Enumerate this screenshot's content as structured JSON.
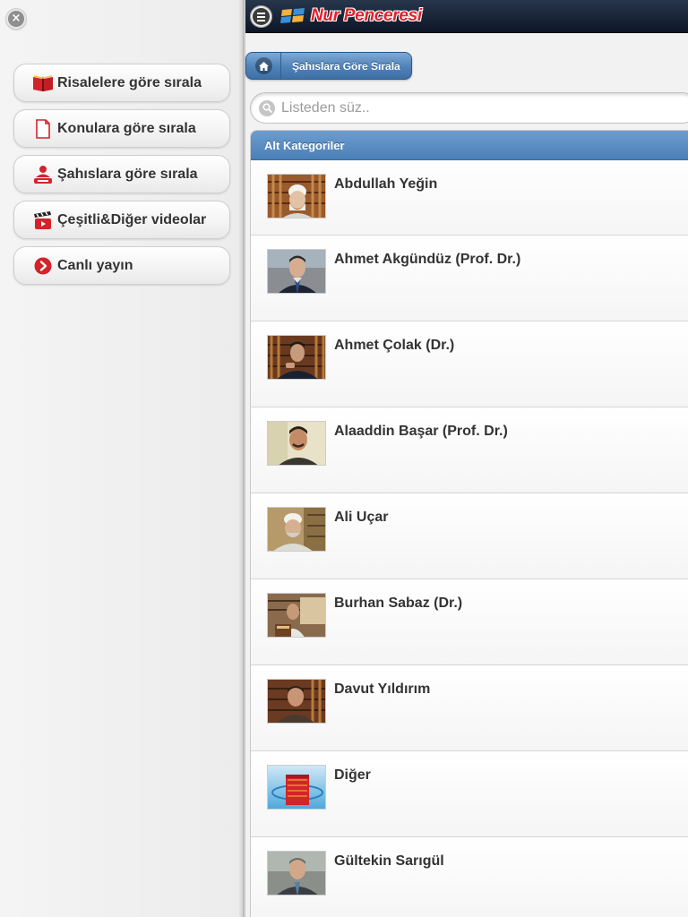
{
  "side_menu": {
    "close_icon": "close-icon",
    "items": [
      {
        "label": "Risalelere göre sırala",
        "icon": "book-icon"
      },
      {
        "label": "Konulara göre sırala",
        "icon": "document-icon"
      },
      {
        "label": "Şahıslara göre sırala",
        "icon": "person-icon"
      },
      {
        "label": "Çeşitli&Diğer videolar",
        "icon": "clapperboard-icon"
      },
      {
        "label": "Canlı yayın",
        "icon": "play-circle-icon"
      }
    ]
  },
  "header": {
    "logo_text": "Nur Penceresi",
    "menu_icon": "menu-icon"
  },
  "breadcrumb": {
    "home_icon": "home-icon",
    "label": "Şahıslara Göre Sırala"
  },
  "search": {
    "placeholder": "Listeden süz.."
  },
  "list": {
    "header": "Alt Kategoriler",
    "items": [
      {
        "name": "Abdullah Yeğin"
      },
      {
        "name": "Ahmet Akgündüz (Prof. Dr.)"
      },
      {
        "name": "Ahmet Çolak (Dr.)"
      },
      {
        "name": "Alaaddin Başar (Prof. Dr.)"
      },
      {
        "name": "Ali Uçar"
      },
      {
        "name": "Burhan Sabaz (Dr.)"
      },
      {
        "name": "Davut Yıldırım"
      },
      {
        "name": "Diğer"
      },
      {
        "name": "Gültekin Sarıgül"
      }
    ]
  },
  "colors": {
    "accent_blue": "#4a7fb7",
    "topbar": "#0d1626",
    "logo_red": "#e4212b"
  }
}
